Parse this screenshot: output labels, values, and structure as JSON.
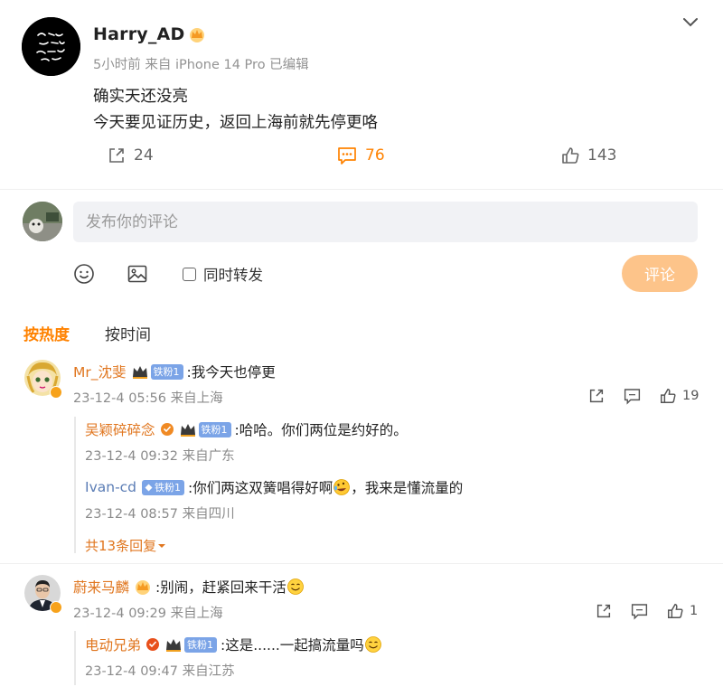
{
  "post": {
    "author": "Harry_AD",
    "meta": "5小时前 来自 iPhone 14 Pro 已编辑",
    "line1": "确实天还没亮",
    "line2": "今天要见证历史，返回上海前就先停更咯",
    "actions": {
      "share": "24",
      "comment": "76",
      "like": "143"
    }
  },
  "composer": {
    "placeholder": "发布你的评论",
    "repost_label": "同时转发",
    "submit_label": "评论"
  },
  "tabs": {
    "hot": "按热度",
    "time": "按时间"
  },
  "comments": [
    {
      "user": "Mr_沈斐",
      "fan_label": "铁粉1",
      "text": ":我今天也停更",
      "time": "23-12-4 05:56 来自上海",
      "likes": "19",
      "replies": [
        {
          "user": "吴颖碎碎念",
          "fan_label": "铁粉1",
          "text": ":哈哈。你们两位是约好的。",
          "time": "23-12-4 09:32 来自广东"
        },
        {
          "user": "Ivan-cd",
          "fan_label": "铁粉1",
          "text": ":你们两这双簧唱得好啊",
          "text_after": "，我来是懂流量的",
          "time": "23-12-4 08:57 来自四川"
        }
      ],
      "more_label": "共13条回复"
    },
    {
      "user": "蔚来马麟",
      "text": ":别闹，赶紧回来干活",
      "time": "23-12-4 09:29 来自上海",
      "likes": "1",
      "replies": [
        {
          "user": "电动兄弟",
          "fan_label": "铁粉1",
          "text": ":这是......一起搞流量吗",
          "time": "23-12-4 09:47 来自江苏"
        }
      ]
    }
  ],
  "colors": {
    "accent": "#ff8200",
    "username": "#e0761f",
    "fan_badge": "#7ba4e7",
    "submit_disabled": "#fdc48a"
  }
}
